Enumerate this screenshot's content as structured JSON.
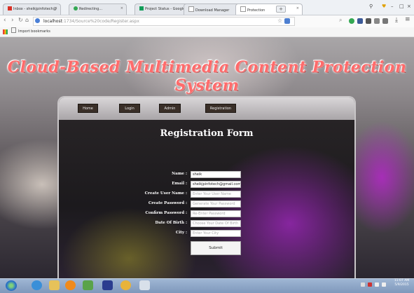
{
  "browser": {
    "tabs": [
      {
        "label": "Inbox - sheikjpinfotech@",
        "active": false,
        "icon": "gmail-icon"
      },
      {
        "label": "Redirecting...",
        "active": false,
        "icon": "loading-icon"
      },
      {
        "label": "Project Status - Google Sh",
        "active": false,
        "icon": "sheets-icon"
      },
      {
        "label": "Download Manager",
        "active": false,
        "icon": "page-icon"
      },
      {
        "label": "Protection",
        "active": true,
        "icon": "page-icon"
      }
    ],
    "new_tab_label": "+",
    "window_controls": {
      "minimize": "–",
      "maximize": "□",
      "close": "×"
    },
    "address": {
      "host": "localhost",
      "path": ":1734/Source%20code/Register.aspx"
    },
    "bookmarks_bar": {
      "label": "Import bookmarks"
    }
  },
  "site": {
    "title": "Cloud-Based Multimedia Content Protection System",
    "nav": [
      "Home",
      "Login",
      "Admin",
      "Registration"
    ]
  },
  "form": {
    "title": "Registration Form",
    "fields": [
      {
        "label": "Name :",
        "value": "sheik",
        "placeholder": ""
      },
      {
        "label": "Email :",
        "value": "sheikjpinfotech@gmail.com",
        "placeholder": ""
      },
      {
        "label": "Create User Name :",
        "value": "",
        "placeholder": "Enter Your User Name"
      },
      {
        "label": "Create Password :",
        "value": "",
        "placeholder": "Generate Your Password"
      },
      {
        "label": "Confirm Password :",
        "value": "",
        "placeholder": "Re-Enter Password"
      },
      {
        "label": "Date Of Birth :",
        "value": "",
        "placeholder": "Choose Your Date Of Birth"
      },
      {
        "label": "City :",
        "value": "",
        "placeholder": "Enter Your City"
      }
    ],
    "submit_label": "Submit"
  },
  "taskbar": {
    "time": "11:07 AM",
    "date": "5/9/2015"
  },
  "colors": {
    "title_red": "#ff6b6b",
    "nav_button": "#3a2f28",
    "taskbar": "#8aa3c5"
  }
}
